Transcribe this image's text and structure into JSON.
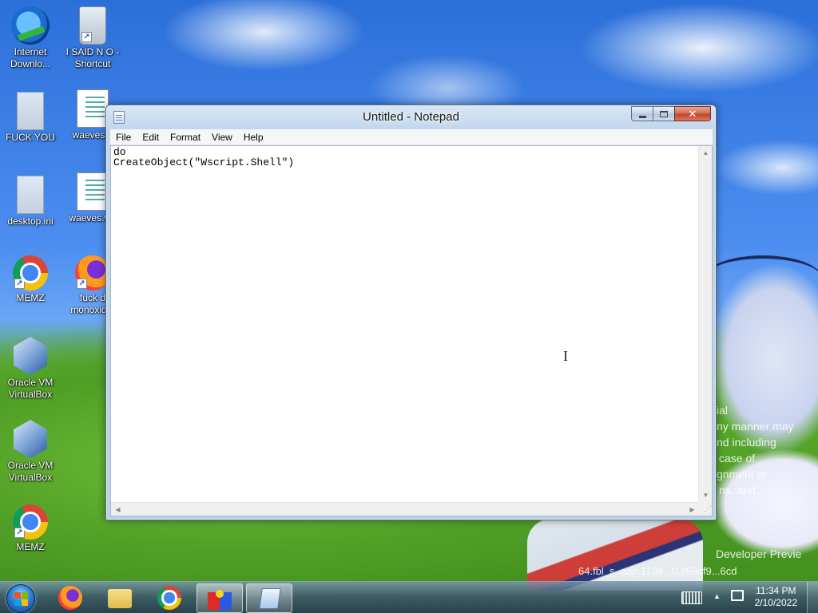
{
  "desktop": {
    "icons": [
      {
        "label": "Internet Downlo...",
        "icon": "internet-download-manager-icon"
      },
      {
        "label": "I SAID N O - Shortcut",
        "icon": "recycle-bin-icon"
      },
      {
        "label": "FUCK YOU",
        "icon": "config-file-icon"
      },
      {
        "label": "waeves...",
        "icon": "script-file-icon"
      },
      {
        "label": "desktop.ini",
        "icon": "config-file-icon"
      },
      {
        "label": "waeves.v...",
        "icon": "script-file-icon"
      },
      {
        "label": "MEMZ",
        "icon": "chrome-icon"
      },
      {
        "label": "fuck d monoxid...",
        "icon": "firefox-icon"
      },
      {
        "label": "Oracle VM VirtualBox",
        "icon": "virtualbox-icon"
      },
      {
        "label": "Oracle VM VirtualBox",
        "icon": "virtualbox-icon"
      },
      {
        "label": "MEMZ",
        "icon": "chrome-icon"
      }
    ],
    "watermark": {
      "lines": [
        "ial",
        "ny manner may",
        "nd including",
        "case of",
        "gnment or",
        "ns, and"
      ],
      "build_title": "Developer Previe",
      "build_string": "64.fbl_s..eap.1108...0.959cf9...6cd"
    }
  },
  "notepad": {
    "title": "Untitled - Notepad",
    "menu": [
      "File",
      "Edit",
      "Format",
      "View",
      "Help"
    ],
    "content_lines": [
      "do",
      "CreateObject(\"Wscript.Shell\")"
    ],
    "close_glyph": "✕"
  },
  "taskbar": {
    "pinned": [
      {
        "name": "firefox",
        "icon": "firefox-icon"
      },
      {
        "name": "explorer",
        "icon": "folder-icon"
      },
      {
        "name": "chrome",
        "icon": "chrome-icon"
      },
      {
        "name": "memz",
        "icon": "memz-icon"
      },
      {
        "name": "notepad",
        "icon": "notepad-icon"
      }
    ],
    "clock": {
      "time": "11:34 PM",
      "date": "2/10/2022"
    },
    "tray_arrow": "▲"
  },
  "colors": {
    "sky": "#4c8ef0",
    "grass": "#4f9e25",
    "close_red": "#c2412a"
  }
}
